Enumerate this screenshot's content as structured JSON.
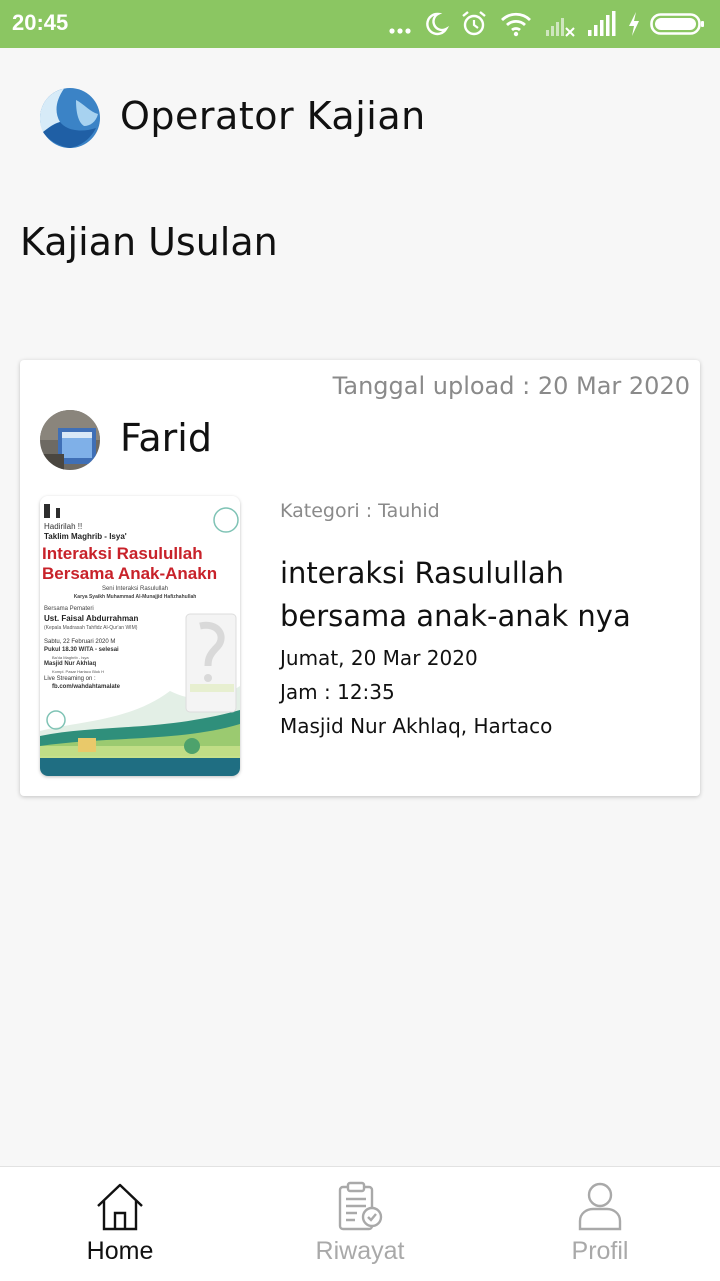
{
  "status_bar": {
    "time": "20:45",
    "icons": [
      "more-icon",
      "moon-icon",
      "alarm-icon",
      "wifi-icon",
      "signal-weak-icon",
      "signal-icon",
      "charging-icon",
      "battery-icon"
    ]
  },
  "header": {
    "logo": "app-logo-icon",
    "title": "Operator Kajian"
  },
  "section_title": "Kajian Usulan",
  "card": {
    "upload_date": "Tanggal upload : 20 Mar 2020",
    "user_name": "Farid",
    "poster": {
      "line1": "Hadirilah !!",
      "line2": "Taklim Maghrib - Isya'",
      "headline1": "Interaksi Rasulullah",
      "headline2": "Bersama Anak-Anakn",
      "sub1": "Seni Interaksi Rasulullah",
      "sub2": "Karya Syaikh Muhammad Al-Munajjid Hafizhahullah",
      "speaker_label": "Bersama Pemateri",
      "speaker": "Ust. Faisal Abdurrahman",
      "speaker_role": "(Kepala Madrasah Tahfidz Al-Qur'an WIM)",
      "date": "Sabtu, 22 Februari 2020 M",
      "time": "Pukul 18.30 WITA - selesai",
      "time_note": "Ba'da Maghrib - Isya",
      "place": "Masjid Nur Akhlaq",
      "place_note": "Kompl. Pasar Hartaco Blok H",
      "stream_label": "Live Streaming on :",
      "stream_url": "fb.com/wahdahtamalate"
    },
    "category": "Kategori : Tauhid",
    "title": "interaksi Rasulullah bersama anak-anak nya",
    "date": "Jumat, 20 Mar 2020",
    "time": "Jam : 12:35",
    "location": "Masjid Nur Akhlaq, Hartaco"
  },
  "bottom_nav": {
    "items": [
      {
        "label": "Home",
        "icon": "home-icon",
        "active": true
      },
      {
        "label": "Riwayat",
        "icon": "history-icon",
        "active": false
      },
      {
        "label": "Profil",
        "icon": "profile-icon",
        "active": false
      }
    ],
    "active_color": "#111111",
    "inactive_color": "#a9a9a9"
  }
}
